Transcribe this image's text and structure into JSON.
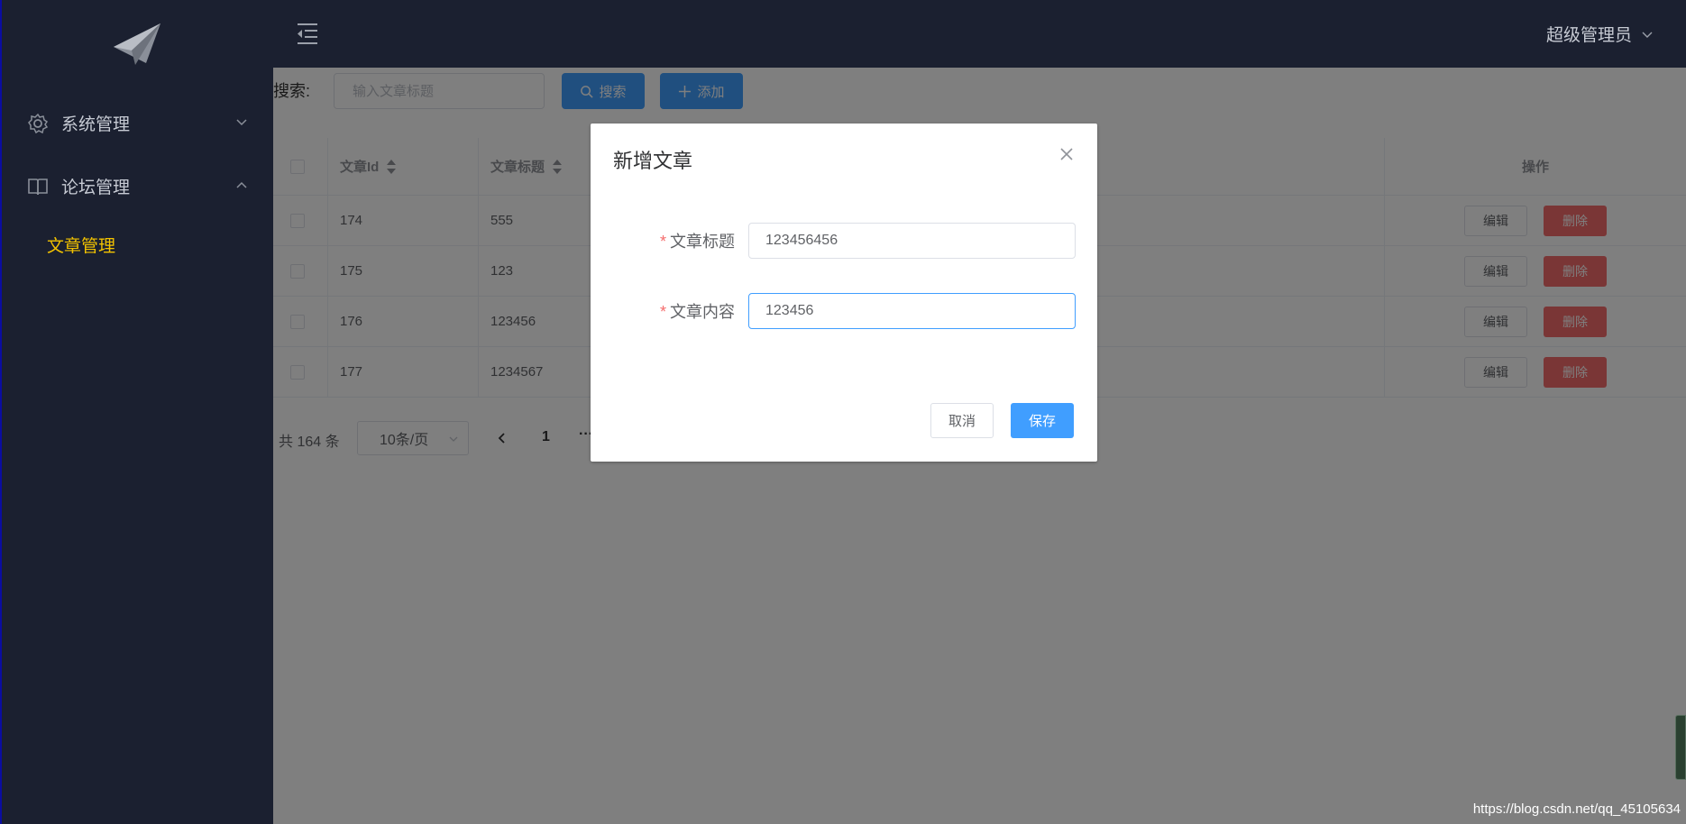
{
  "sidebar": {
    "logo": "paper-plane-icon",
    "menu": [
      {
        "label": "系统管理",
        "icon": "gear-icon",
        "expanded": false
      },
      {
        "label": "论坛管理",
        "icon": "book-icon",
        "expanded": true
      }
    ],
    "submenu": [
      {
        "label": "文章管理",
        "active": true
      }
    ],
    "active_color": "#f2c200"
  },
  "header": {
    "user": "超级管理员"
  },
  "toolbar": {
    "search_label": "搜索:",
    "search_placeholder": "输入文章标题",
    "search_button": "搜索",
    "add_button": "添加"
  },
  "table": {
    "columns": {
      "id": "文章Id",
      "title": "文章标题",
      "actions": "操作"
    },
    "rows": [
      {
        "id": "174",
        "title": "555"
      },
      {
        "id": "175",
        "title": "123"
      },
      {
        "id": "176",
        "title": "123456"
      },
      {
        "id": "177",
        "title": "1234567"
      }
    ],
    "edit_label": "编辑",
    "delete_label": "删除"
  },
  "pagination": {
    "total": "共 164 条",
    "page_size": "10条/页",
    "current": "1",
    "more": "···"
  },
  "dialog": {
    "title": "新增文章",
    "fields": [
      {
        "label": "文章标题",
        "value": "123456456",
        "required": true
      },
      {
        "label": "文章内容",
        "value": "123456",
        "required": true
      }
    ],
    "cancel": "取消",
    "save": "保存"
  },
  "watermark": "https://blog.csdn.net/qq_45105634",
  "colors": {
    "sidebar_bg": "#1b2030",
    "primary": "#409eff",
    "danger": "#f56c6c"
  }
}
